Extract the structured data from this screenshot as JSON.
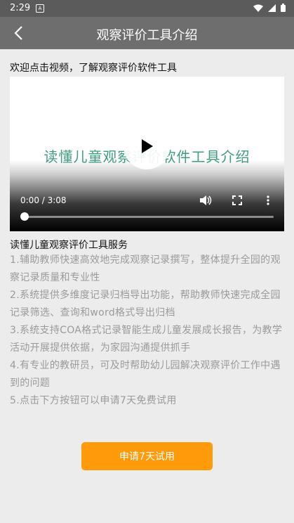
{
  "status_bar": {
    "time": "2:29",
    "notification_icon": "notification-icon",
    "wifi_icon": "wifi-icon",
    "signal_icon": "signal-icon",
    "battery_icon": "battery-icon"
  },
  "app_bar": {
    "title": "观察评价工具介绍",
    "back_icon": "chevron-left-icon"
  },
  "intro_text": "欢迎点击视频，了解观察评价软件工具",
  "video": {
    "caption": "读懂儿童观察评价软件工具介绍",
    "caption_color": "#3e9d7c",
    "time": "0:00 / 3:08",
    "progress": 0,
    "play_icon": "play-icon",
    "volume_icon": "volume-icon",
    "fullscreen_icon": "fullscreen-icon",
    "more_icon": "more-vertical-icon"
  },
  "services": {
    "heading": "读懂儿童观察评价工具服务",
    "items": [
      "1.辅助教师快速高效地完成观察记录撰写，整体提升全园的观察记录质量和专业性",
      "2.系统提供多维度记录归档导出功能，帮助教师快速完成全园记录筛选、查询和word格式导出归档",
      "3.系统支持COA格式记录智能生成儿童发展成长报告，为教学活动开展提供依据，为家园沟通提供抓手",
      "4.有专业的教研员，可及时帮助幼儿园解决观察评价工作中遇到的问题",
      "5.点击下方按钮可以申请7天免费试用"
    ]
  },
  "trial_button": {
    "label": "申请7天试用",
    "color": "#ff9a0a"
  }
}
